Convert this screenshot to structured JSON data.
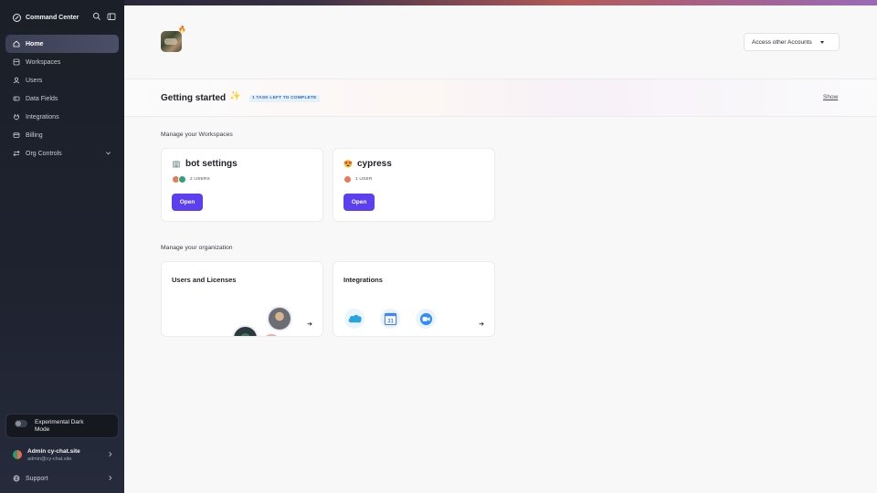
{
  "sidebar": {
    "brand": "Command Center",
    "items": [
      {
        "label": "Home",
        "icon": "home-icon"
      },
      {
        "label": "Workspaces",
        "icon": "workspaces-icon"
      },
      {
        "label": "Users",
        "icon": "users-icon"
      },
      {
        "label": "Data Fields",
        "icon": "data-fields-icon"
      },
      {
        "label": "Integrations",
        "icon": "integrations-icon"
      },
      {
        "label": "Billing",
        "icon": "billing-icon"
      },
      {
        "label": "Org Controls",
        "icon": "org-controls-icon"
      }
    ],
    "dark_mode_label": "Experimental Dark Mode",
    "account": {
      "name": "Admin cy-chat.site",
      "email": "admin@cy-chat.site"
    },
    "support_label": "Support"
  },
  "header": {
    "access_button": "Access other Accounts"
  },
  "getting_started": {
    "title": "Getting started",
    "badge": "1 TASK LEFT TO COMPLETE",
    "show_label": "Show"
  },
  "workspaces": {
    "section_title": "Manage your Workspaces",
    "items": [
      {
        "name": "bot settings",
        "users": "2 USERS",
        "open_label": "Open"
      },
      {
        "name": "cypress",
        "users": "1 USER",
        "open_label": "Open"
      }
    ]
  },
  "organization": {
    "section_title": "Manage your organization",
    "cards": [
      {
        "title": "Users and Licenses"
      },
      {
        "title": "Integrations"
      }
    ]
  },
  "colors": {
    "accent": "#5b3ff0",
    "sidebar_bg": "#1f2330",
    "badge_text": "#2d6bc2"
  }
}
